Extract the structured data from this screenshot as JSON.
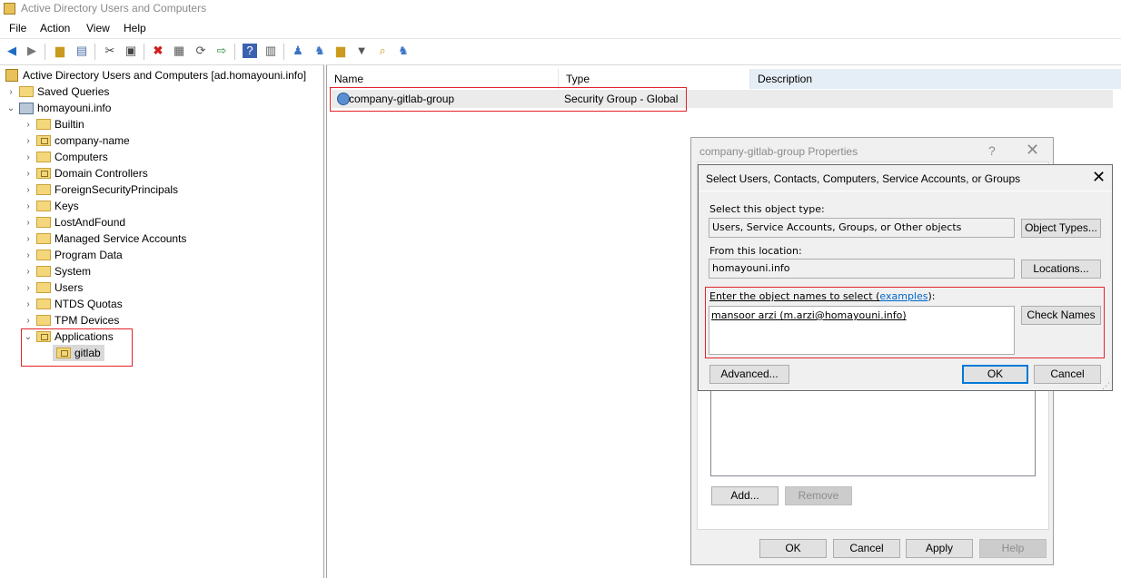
{
  "window": {
    "title": "Active Directory Users and Computers"
  },
  "menu": [
    "File",
    "Action",
    "View",
    "Help"
  ],
  "toolbar_icons": [
    "back-arrow-icon",
    "forward-arrow-icon",
    "up-folder-icon",
    "show-console-tree-icon",
    "cut-icon",
    "copy-icon",
    "delete-icon",
    "properties-icon",
    "refresh-icon",
    "export-list-icon",
    "help-icon",
    "action-pane-icon",
    "new-user-icon",
    "new-group-icon",
    "new-ou-icon",
    "filter-icon",
    "find-icon",
    "add-to-group-icon"
  ],
  "tree": {
    "root": "Active Directory Users and Computers [ad.homayouni.info]",
    "saved_queries": "Saved Queries",
    "domain": "homayouni.info",
    "children": [
      "Builtin",
      "company-name",
      "Computers",
      "Domain Controllers",
      "ForeignSecurityPrincipals",
      "Keys",
      "LostAndFound",
      "Managed Service Accounts",
      "Program Data",
      "System",
      "Users",
      "NTDS Quotas",
      "TPM Devices"
    ],
    "applications": "Applications",
    "gitlab": "gitlab"
  },
  "list": {
    "columns": [
      "Name",
      "Type",
      "Description"
    ],
    "rows": [
      {
        "name": "company-gitlab-group",
        "type": "Security Group - Global"
      }
    ]
  },
  "properties_dialog": {
    "title": "company-gitlab-group Properties",
    "help_glyph": "?",
    "add": "Add...",
    "remove": "Remove",
    "ok": "OK",
    "cancel": "Cancel",
    "apply": "Apply",
    "help": "Help"
  },
  "select_dialog": {
    "title": "Select Users, Contacts, Computers, Service Accounts, or Groups",
    "object_type_label": "Select this object type:",
    "object_type_value": "Users, Service Accounts, Groups, or Other objects",
    "object_types_button": "Object Types...",
    "location_label": "From this location:",
    "location_value": "homayouni.info",
    "locations_button": "Locations...",
    "names_label_prefix": "Enter the object names to select (",
    "names_label_link": "examples",
    "names_label_suffix": "):",
    "names_value": "mansoor arzi (m.arzi@homayouni.info)",
    "check_names_button": "Check Names",
    "advanced_button": "Advanced...",
    "ok_button": "OK",
    "cancel_button": "Cancel"
  }
}
